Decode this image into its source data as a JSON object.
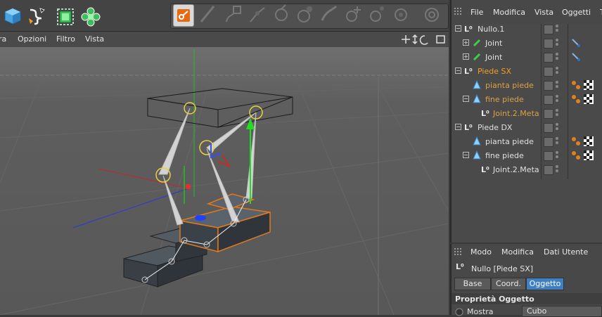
{
  "viewport_menu": [
    "ra",
    "Opzioni",
    "Filtro",
    "Vista"
  ],
  "object_manager": {
    "menu": [
      "File",
      "Modifica",
      "Vista",
      "Oggetti",
      "T"
    ],
    "rows": [
      {
        "label": "Nullo.1",
        "color": "#e0e0e0",
        "type": "null"
      },
      {
        "label": "Joint",
        "color": "#e0e0e0",
        "type": "joint"
      },
      {
        "label": "Joint",
        "color": "#e0e0e0",
        "type": "joint"
      },
      {
        "label": "Piede SX",
        "color": "#f0a020",
        "type": "null"
      },
      {
        "label": "pianta piede",
        "color": "#e0a040",
        "type": "bone"
      },
      {
        "label": "fine piede",
        "color": "#e0a040",
        "type": "bone"
      },
      {
        "label": "Joint.2.Meta",
        "color": "#e0a040",
        "type": "null"
      },
      {
        "label": "Piede DX",
        "color": "#e0e0e0",
        "type": "null"
      },
      {
        "label": "pianta piede",
        "color": "#e0e0e0",
        "type": "bone"
      },
      {
        "label": "fine piede",
        "color": "#e0e0e0",
        "type": "bone"
      },
      {
        "label": "Joint.2.Meta",
        "color": "#e0e0e0",
        "type": "null"
      }
    ]
  },
  "attributes": {
    "menu": [
      "Modo",
      "Modifica",
      "Dati Utente"
    ],
    "object_title": "Nullo [Piede SX]",
    "tabs": [
      "Base",
      "Coord.",
      "Oggetto"
    ],
    "active_tab": "Oggetto",
    "section_title": "Proprietà Oggetto",
    "field_label": "Mostra",
    "field_value": "Cubo"
  },
  "colors": {
    "accent": "#f0a020",
    "selected_tab": "#3f7fc4",
    "panel": "#4a4a4a"
  }
}
